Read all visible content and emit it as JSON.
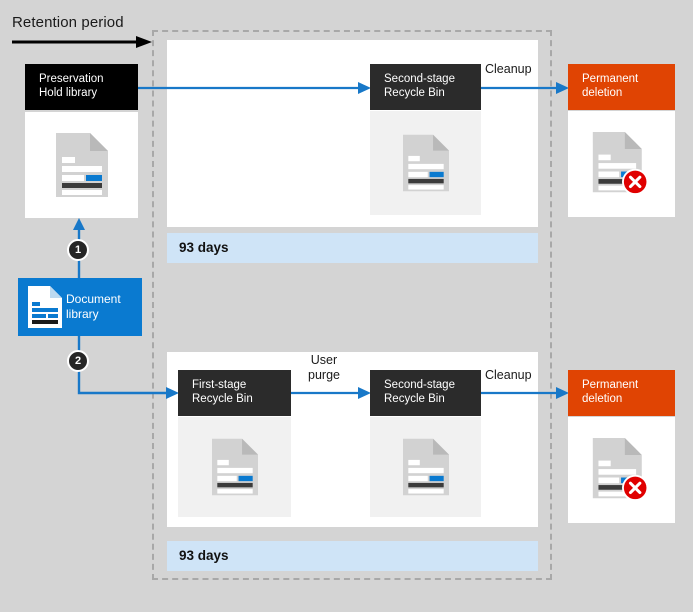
{
  "diagram": {
    "title": "Retention period",
    "background_color": "#d4d4d4",
    "accent_blue": "#0a7ad0",
    "accent_orange": "#e04403",
    "accent_red": "#e00000",
    "dark_box_color": "#2b2b2b"
  },
  "header": {
    "retention_label": "Retention period",
    "arrow_icon": "right-arrow-icon"
  },
  "left_column": {
    "preservation_hold": {
      "label": "Preservation\nHold library",
      "line1": "Preservation",
      "line2": "Hold library",
      "thumbnail": "document-icon"
    },
    "document_library": {
      "label": "Document\nlibrary",
      "line1": "Document",
      "line2": "library",
      "icon": "document-icon"
    },
    "steps": [
      {
        "number": "1",
        "to": "preservation-hold-library"
      },
      {
        "number": "2",
        "to": "first-stage-recycle-bin"
      }
    ]
  },
  "top_flow": {
    "second_stage_recycle_bin": {
      "line1": "Second-stage",
      "line2": "Recycle Bin",
      "thumbnail": "document-icon"
    },
    "cleanup_label": "Cleanup",
    "permanent_deletion": {
      "line1": "Permanent",
      "line2": "deletion",
      "thumbnail": "document-deleted-icon",
      "badge": "red-x-icon"
    },
    "retention_bar": "93 days"
  },
  "bottom_flow": {
    "first_stage_recycle_bin": {
      "line1": "First-stage",
      "line2": "Recycle Bin",
      "thumbnail": "document-icon"
    },
    "user_purge_label_line1": "User",
    "user_purge_label_line2": "purge",
    "second_stage_recycle_bin": {
      "line1": "Second-stage",
      "line2": "Recycle Bin",
      "thumbnail": "document-icon"
    },
    "cleanup_label": "Cleanup",
    "permanent_deletion": {
      "line1": "Permanent",
      "line2": "deletion",
      "thumbnail": "document-deleted-icon",
      "badge": "red-x-icon"
    },
    "retention_bar": "93 days"
  }
}
